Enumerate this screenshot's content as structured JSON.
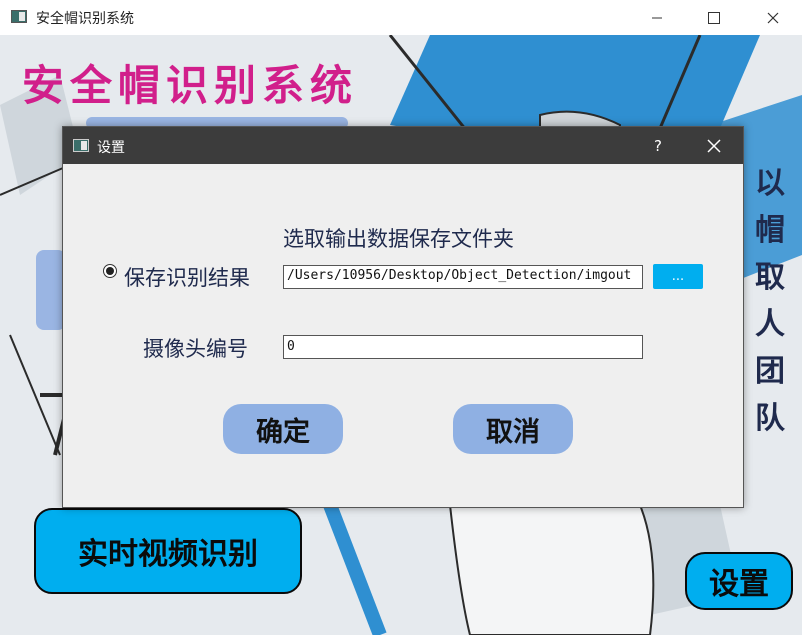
{
  "window": {
    "title": "安全帽识别系统",
    "minimize_icon": "minimize-icon",
    "maximize_icon": "maximize-icon",
    "close_icon": "close-icon"
  },
  "main": {
    "app_title": "安全帽识别系统",
    "slogan_chars": [
      "以",
      "帽",
      "取",
      "人",
      "团",
      "队"
    ],
    "realtime_button": "实时视频识别",
    "settings_button": "设置"
  },
  "dialog": {
    "title": "设置",
    "help": "?",
    "heading": "选取输出数据保存文件夹",
    "save_option_label": "保存识别结果",
    "save_option_checked": true,
    "output_path": "/Users/10956/Desktop/Object_Detection/imgout",
    "browse_label": "...",
    "camera_label": "摄像头编号",
    "camera_value": "0",
    "ok_label": "确定",
    "cancel_label": "取消"
  },
  "colors": {
    "title_magenta": "#d11f8b",
    "accent_blue": "#00aeef",
    "dialog_button_blue": "#8fb0e3",
    "dialog_titlebar": "#3c3c3c",
    "text_navy": "#1f2a4d"
  }
}
